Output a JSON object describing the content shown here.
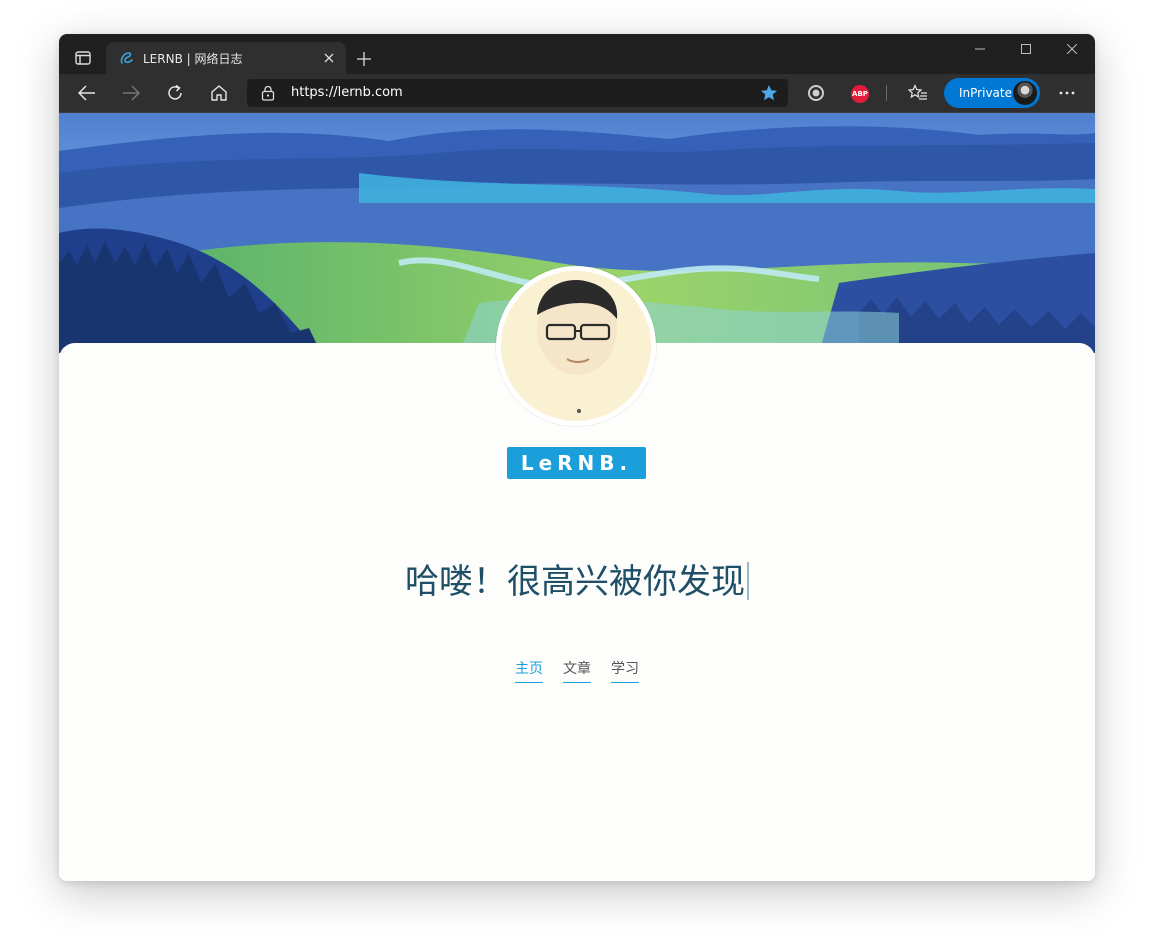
{
  "browser": {
    "tab": {
      "title": "LERNB | 网络日志",
      "favicon": "lernb-favicon-icon"
    },
    "address": {
      "url": "https://lernb.com"
    },
    "profile": {
      "label": "InPrivate"
    },
    "extensions": {
      "abp_label": "ABP"
    },
    "colors": {
      "chrome_dark": "#202020",
      "toolbar": "#2f2f2f",
      "inprivate_blue": "#0078d4",
      "accent_blue": "#1b9fdb"
    }
  },
  "site": {
    "logo_text": "LeRNB.",
    "headline": "哈喽！很高兴被你发现",
    "nav": [
      {
        "label": "主页",
        "active": true
      },
      {
        "label": "文章",
        "active": false
      },
      {
        "label": "学习",
        "active": false
      }
    ],
    "colors": {
      "headline": "#1e4f66",
      "accent": "#1b9fdb"
    }
  }
}
